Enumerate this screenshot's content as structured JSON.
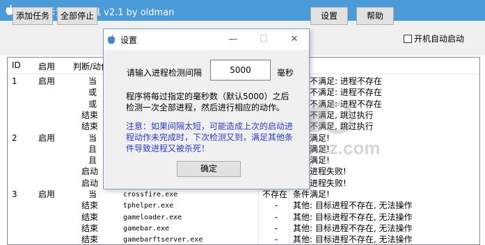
{
  "window": {
    "title": "进程互斥监控小工具 v2.1 by oldman"
  },
  "toolbar": {
    "add_task": "添加任务",
    "stop_all": "全部停止",
    "settings": "设置",
    "help": "帮助",
    "autostart_label": "开机自动启动"
  },
  "list": {
    "headers": {
      "id": "ID",
      "enabled": "启用",
      "cond": "判断/动作",
      "state": "",
      "result": ""
    },
    "rows": [
      {
        "id": "1",
        "en": "启用",
        "cond": "当",
        "proc": "",
        "state": "",
        "result": "条件不满足: 进程不存在"
      },
      {
        "id": "",
        "en": "",
        "cond": "或",
        "proc": "",
        "state": "",
        "result": "条件不满足: 进程不存在"
      },
      {
        "id": "",
        "en": "",
        "cond": "或",
        "proc": "",
        "state": "",
        "result": "条件不满足: 进程不存在"
      },
      {
        "id": "",
        "en": "",
        "cond": "结束",
        "proc": "",
        "state": "",
        "result": "条件不满足, 跳过执行"
      },
      {
        "id": "",
        "en": "",
        "cond": "结束",
        "proc": "",
        "state": "",
        "result": "条件不满足, 跳过执行"
      },
      {
        "id": "2",
        "en": "启用",
        "cond": "当",
        "proc": "",
        "state": "",
        "result": "条件满足!"
      },
      {
        "id": "",
        "en": "",
        "cond": "且",
        "proc": "",
        "state": "",
        "result": "条件满足!"
      },
      {
        "id": "",
        "en": "",
        "cond": "且",
        "proc": "",
        "state": "",
        "result": "条件满足!"
      },
      {
        "id": "",
        "en": "",
        "cond": "启动",
        "proc": "",
        "state": "",
        "result": "启动进程失败!"
      },
      {
        "id": "",
        "en": "",
        "cond": "启动",
        "proc": "",
        "state": "",
        "result": "启动进程失败!"
      },
      {
        "id": "3",
        "en": "启用",
        "cond": "当",
        "proc": "crossfire.exe",
        "state": "不存在",
        "result": "条件满足!"
      },
      {
        "id": "",
        "en": "",
        "cond": "结束",
        "proc": "tphelper.exe",
        "state": "-",
        "result": "其他: 目标进程不存在, 无法操作"
      },
      {
        "id": "",
        "en": "",
        "cond": "结束",
        "proc": "gameloader.exe",
        "state": "-",
        "result": "其他: 目标进程不存在, 无法操作"
      },
      {
        "id": "",
        "en": "",
        "cond": "结束",
        "proc": "gamebar.exe",
        "state": "-",
        "result": "其他: 目标进程不存在, 无法操作"
      },
      {
        "id": "",
        "en": "",
        "cond": "结束",
        "proc": "gamebarftserver.exe",
        "state": "-",
        "result": "其他: 目标进程不存在, 无法操作"
      }
    ]
  },
  "dialog": {
    "title": "设置",
    "prompt": "请输入进程检测间隔",
    "interval_value": "5000",
    "unit": "毫秒",
    "description": "程序将每过指定的毫秒数（默认5000）之后检测一次全部进程，然后进行相应的动作。",
    "note": "注意：如果间隔太短，可能造成上次的启动进程动作未完成时，下次检测又到，满足其他条件导致进程又被杀死！",
    "ok": "确定"
  },
  "watermark": {
    "text": "anxz.com"
  },
  "colors": {
    "titlebar": "#4c9bd9",
    "note_text": "#2a3cc8"
  }
}
